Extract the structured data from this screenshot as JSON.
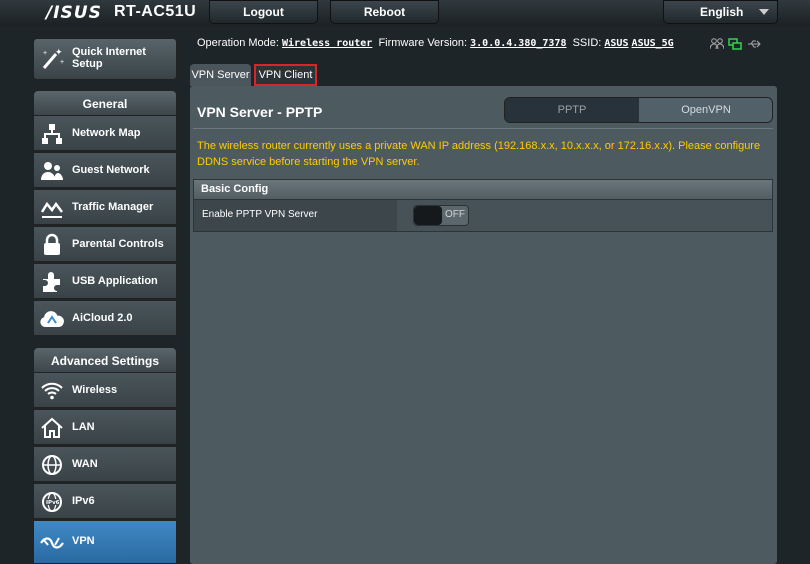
{
  "header": {
    "brand": "/ISUS",
    "model": "RT-AC51U",
    "logout": "Logout",
    "reboot": "Reboot",
    "language": "English"
  },
  "sidebar": {
    "quick_setup": "Quick Internet Setup",
    "general_title": "General",
    "general_items": [
      {
        "label": "Network Map",
        "icon": "network-map-icon"
      },
      {
        "label": "Guest Network",
        "icon": "guest-network-icon"
      },
      {
        "label": "Traffic Manager",
        "icon": "traffic-manager-icon"
      },
      {
        "label": "Parental Controls",
        "icon": "parental-controls-icon"
      },
      {
        "label": "USB Application",
        "icon": "usb-application-icon"
      },
      {
        "label": "AiCloud 2.0",
        "icon": "aicloud-icon"
      }
    ],
    "advanced_title": "Advanced Settings",
    "advanced_items": [
      {
        "label": "Wireless",
        "icon": "wireless-icon"
      },
      {
        "label": "LAN",
        "icon": "lan-icon"
      },
      {
        "label": "WAN",
        "icon": "wan-icon"
      },
      {
        "label": "IPv6",
        "icon": "ipv6-icon"
      },
      {
        "label": "VPN",
        "icon": "vpn-icon",
        "active": true
      }
    ]
  },
  "status": {
    "op_mode_label": "Operation Mode:",
    "op_mode_value": "Wireless router",
    "fw_label": "Firmware Version:",
    "fw_value": "3.0.0.4.380_7378",
    "ssid_label": "SSID:",
    "ssid1": "ASUS",
    "ssid2": "ASUS_5G"
  },
  "tabs": [
    {
      "label": "VPN Server",
      "selected": true
    },
    {
      "label": "VPN Client",
      "highlighted": true
    }
  ],
  "main": {
    "title": "VPN Server - PPTP",
    "segments": [
      "PPTP",
      "OpenVPN"
    ],
    "notice": "The wireless router currently uses a private WAN IP address (192.168.x.x, 10.x.x.x, or 172.16.x.x). Please configure DDNS service before starting the VPN server.",
    "section_title": "Basic Config",
    "row_label": "Enable PPTP VPN Server",
    "toggle_state": "OFF"
  },
  "colors": {
    "accent_active": "#3f89c4",
    "notice": "#ffcc00",
    "highlight_border": "#d9242b"
  }
}
